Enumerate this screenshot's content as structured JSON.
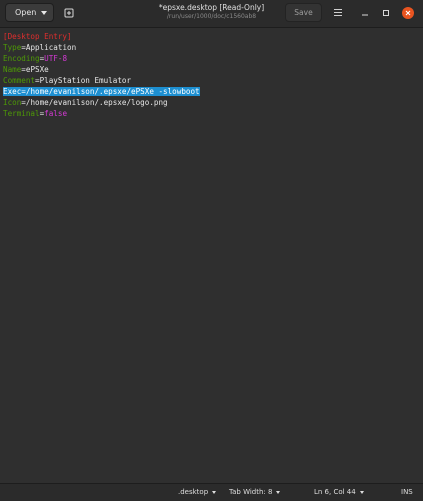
{
  "toolbar": {
    "open_label": "Open",
    "save_label": "Save"
  },
  "window": {
    "title": "*epsxe.desktop [Read-Only]",
    "subtitle": "/run/user/1000/doc/c1560ab8"
  },
  "document": {
    "lines": [
      {
        "section": "[Desktop Entry]"
      },
      {
        "key": "Type",
        "eq": "=",
        "value": "Application"
      },
      {
        "key": "Encoding",
        "eq": "=",
        "value": "UTF-8",
        "value_style": "purple"
      },
      {
        "key": "Name",
        "eq": "=",
        "value": "ePSXe"
      },
      {
        "key": "Comment",
        "eq": "=",
        "value": "PlayStation Emulator"
      },
      {
        "key": "Exec",
        "eq": "=",
        "value": "/home/evanilson/.epsxe/ePSXe -slowboot",
        "selected": true
      },
      {
        "key": "Icon",
        "eq": "=",
        "value": "/home/evanilson/.epsxe/logo.png"
      },
      {
        "key": "Terminal",
        "eq": "=",
        "value": "false",
        "value_style": "purple"
      }
    ]
  },
  "status": {
    "language": ".desktop",
    "tab_width": "Tab Width: 8",
    "cursor": "Ln 6, Col 44",
    "mode": "INS"
  },
  "colors": {
    "close_button": "#e95420",
    "selection": "#1d8fd1",
    "section": "#df2e2e",
    "key": "#4e9a06",
    "special_value": "#d63ad6"
  }
}
